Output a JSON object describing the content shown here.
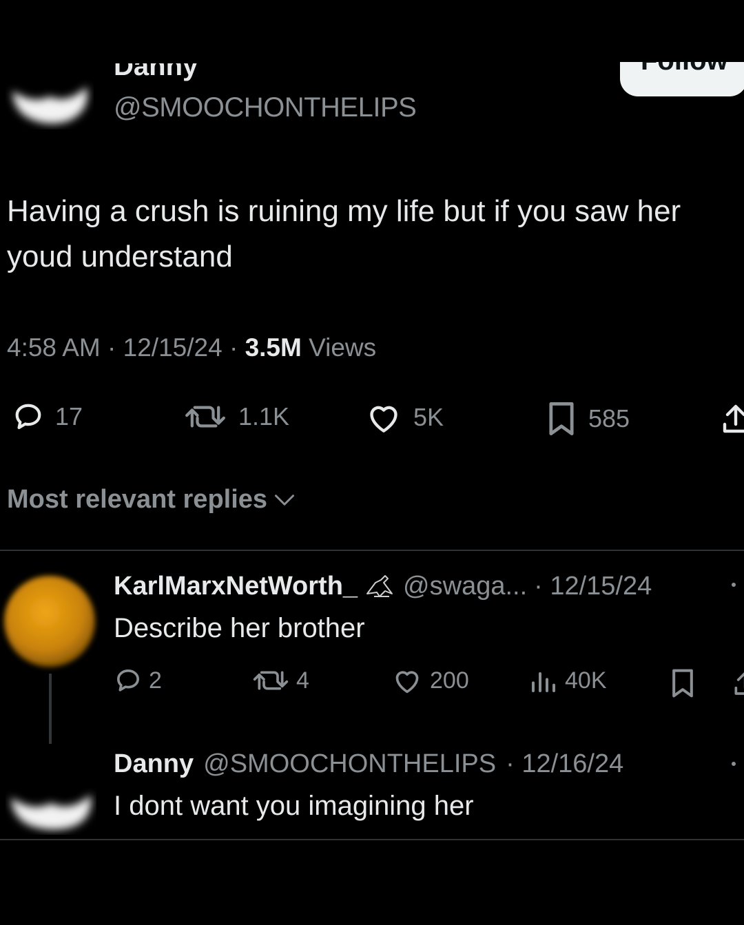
{
  "header": {
    "display_name": "Danny",
    "handle": "@SMOOCHONTHELIPS",
    "follow_label": "Follow"
  },
  "tweet": {
    "text": "Having a crush is ruining my life but if you saw her youd understand",
    "time": "4:58 AM",
    "date": "12/15/24",
    "views_count": "3.5M",
    "views_label": "Views",
    "separator": "·",
    "actions": {
      "replies": "17",
      "reposts": "1.1K",
      "likes": "5K",
      "bookmarks": "585"
    }
  },
  "replies_header": {
    "label": "Most relevant replies"
  },
  "replies": [
    {
      "name": "KarlMarxNetWorth_",
      "handle": "@swaga...",
      "date": "· 12/15/24",
      "text": "Describe her brother",
      "actions": {
        "replies": "2",
        "reposts": "4",
        "likes": "200",
        "views": "40K"
      }
    },
    {
      "name": "Danny",
      "handle": "@SMOOCHONTHELIPS",
      "date": "· 12/16/24",
      "text": "I dont want you imagining her"
    }
  ],
  "colors": {
    "background": "#000000",
    "text": "#e7e9ea",
    "muted": "#8b9095",
    "divider": "#2f3336",
    "orange_avatar": "#d98c0a"
  }
}
